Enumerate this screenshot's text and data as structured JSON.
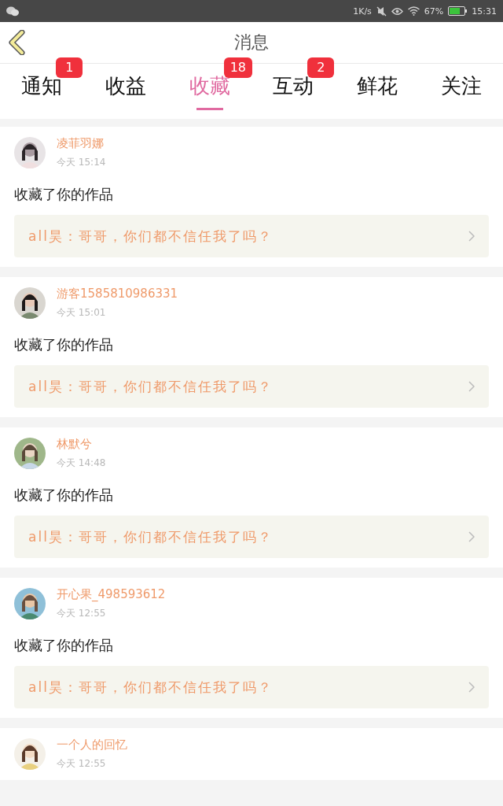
{
  "status_bar": {
    "speed": "1K/s",
    "battery": "67%",
    "time": "15:31"
  },
  "header": {
    "title": "消息"
  },
  "tabs": [
    {
      "label": "通知",
      "selected": false,
      "badge": "1"
    },
    {
      "label": "收益",
      "selected": false
    },
    {
      "label": "收藏",
      "selected": true,
      "badge": "18"
    },
    {
      "label": "互动",
      "selected": false,
      "badge": "2"
    },
    {
      "label": "鲜花",
      "selected": false
    },
    {
      "label": "关注",
      "selected": false
    }
  ],
  "messages": [
    {
      "name": "凌菲羽娜",
      "time": "今天 15:14",
      "action": "收藏了你的作品",
      "quote": "all昊：哥哥，你们都不信任我了吗？"
    },
    {
      "name": "游客1585810986331",
      "time": "今天 15:01",
      "action": "收藏了你的作品",
      "quote": "all昊：哥哥，你们都不信任我了吗？"
    },
    {
      "name": "林默兮",
      "time": "今天 14:48",
      "action": "收藏了你的作品",
      "quote": "all昊：哥哥，你们都不信任我了吗？"
    },
    {
      "name": "开心果_498593612",
      "time": "今天 12:55",
      "action": "收藏了你的作品",
      "quote": "all昊：哥哥，你们都不信任我了吗？"
    },
    {
      "name": "一个人的回忆",
      "time": "今天 12:55"
    }
  ]
}
